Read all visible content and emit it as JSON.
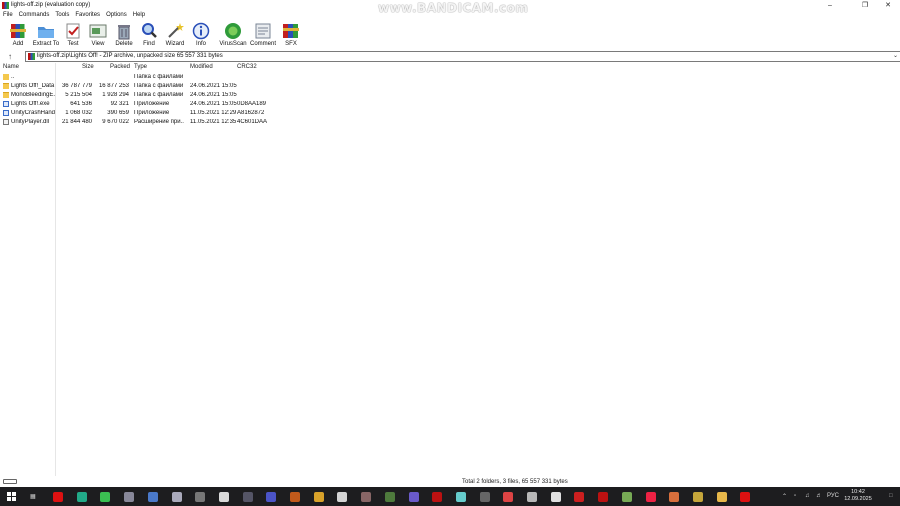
{
  "window": {
    "title": "lights-off.zip (evaluation copy)",
    "watermark": "www.BANDICAM.com",
    "minimize_icon": "minimize-icon",
    "maximize_icon": "restore-icon",
    "close_icon": "close-icon"
  },
  "menu": [
    "File",
    "Commands",
    "Tools",
    "Favorites",
    "Options",
    "Help"
  ],
  "toolbar": [
    {
      "label": "Add",
      "icon": "add-archive-icon"
    },
    {
      "label": "Extract To",
      "icon": "extract-folder-icon"
    },
    {
      "label": "Test",
      "icon": "test-icon"
    },
    {
      "label": "View",
      "icon": "view-icon"
    },
    {
      "label": "Delete",
      "icon": "delete-icon"
    },
    {
      "label": "Find",
      "icon": "find-icon"
    },
    {
      "label": "Wizard",
      "icon": "wizard-icon"
    },
    {
      "label": "Info",
      "icon": "info-icon"
    },
    {
      "label": "VirusScan",
      "icon": "virusscan-icon"
    },
    {
      "label": "Comment",
      "icon": "comment-icon"
    },
    {
      "label": "SFX",
      "icon": "sfx-icon"
    }
  ],
  "address": {
    "path": "lights-off.zip\\Lights Off! - ZIP archive, unpacked size 65 557 331 bytes"
  },
  "columns": {
    "name": "Name",
    "size": "Size",
    "packed": "Packed",
    "type": "Type",
    "modified": "Modified",
    "crc": "CRC32"
  },
  "files": [
    {
      "name": "..",
      "size": "",
      "packed": "",
      "type": "Папка с файлами",
      "modified": "",
      "crc": "",
      "kind": "updir"
    },
    {
      "name": "Lights Off!_Data",
      "size": "36 787 779",
      "packed": "16 877 253",
      "type": "Папка с файлами",
      "modified": "24.06.2021 15:05",
      "crc": "",
      "kind": "folder"
    },
    {
      "name": "MonoBleedingE...",
      "size": "5 215 504",
      "packed": "1 928 294",
      "type": "Папка с файлами",
      "modified": "24.06.2021 15:05",
      "crc": "",
      "kind": "folder"
    },
    {
      "name": "Lights Off!.exe",
      "size": "641 536",
      "packed": "92 321",
      "type": "Приложение",
      "modified": "24.06.2021 15:05",
      "crc": "0D8AA189",
      "kind": "exe"
    },
    {
      "name": "UnityCrashHand...",
      "size": "1 068 032",
      "packed": "390 659",
      "type": "Приложение",
      "modified": "11.05.2021 12:29",
      "crc": "A8162872",
      "kind": "exe"
    },
    {
      "name": "UnityPlayer.dll",
      "size": "21 844 480",
      "packed": "9 670 022",
      "type": "Расширение при...",
      "modified": "11.05.2021 12:35",
      "crc": "4C601DAA",
      "kind": "dll"
    }
  ],
  "status": {
    "text": "Total 2 folders, 3 files, 65 557 331 bytes"
  },
  "taskbar": {
    "language": "РУС",
    "time": "10:42",
    "date": "12.09.2025",
    "apps": [
      "opera-icon",
      "app-icon",
      "app-icon",
      "app-icon",
      "app-icon",
      "app-icon",
      "app-icon",
      "app-icon",
      "app-icon",
      "app-icon",
      "app-icon",
      "app-icon",
      "app-icon",
      "app-icon",
      "app-icon",
      "app-icon",
      "app-icon",
      "app-icon",
      "app-icon",
      "app-icon",
      "app-icon",
      "app-icon",
      "app-icon",
      "app-icon",
      "app-icon",
      "app-icon",
      "app-icon",
      "app-icon",
      "winrar-icon",
      "bandicam-icon"
    ],
    "app_colors": [
      "#d11",
      "#2a8",
      "#3bbf52",
      "#889",
      "#4a79c9",
      "#aab",
      "#777",
      "#d9d9d9",
      "#556",
      "#4b54c7",
      "#c25a1b",
      "#d8a22a",
      "#d4d4d4",
      "#866",
      "#4e7a3c",
      "#6a5ac9",
      "#b11",
      "#6cc",
      "#666",
      "#d44",
      "#b8b8b8",
      "#e0e0e0",
      "#cc1f1f",
      "#b11",
      "#7a5",
      "#e24",
      "#d86f3c",
      "#c5a63b",
      "#e8b84a",
      "#d11"
    ]
  }
}
